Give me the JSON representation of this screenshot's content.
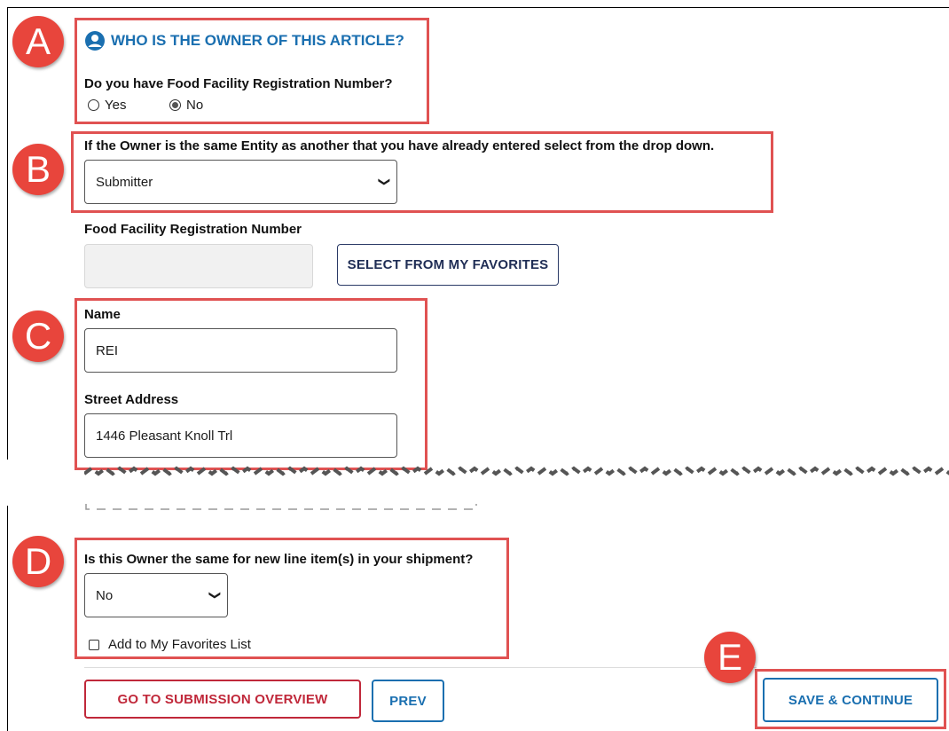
{
  "callouts": {
    "a": "A",
    "b": "B",
    "c": "C",
    "d": "D",
    "e": "E"
  },
  "owner_section": {
    "title": "WHO IS THE OWNER OF THIS ARTICLE?",
    "icon": "user-circle-icon",
    "question": "Do you have Food Facility Registration Number?",
    "options": {
      "yes": "Yes",
      "no": "No"
    },
    "selected": "No"
  },
  "same_entity": {
    "label": "If the Owner is the same Entity as another that you have already entered select from the drop down.",
    "selected": "Submitter"
  },
  "registration": {
    "label": "Food Facility Registration Number",
    "value": "",
    "favorites_button": "SELECT FROM MY FAVORITES"
  },
  "name": {
    "label": "Name",
    "value": "REI"
  },
  "street": {
    "label": "Street Address",
    "value": "1446 Pleasant Knoll Trl"
  },
  "line_items": {
    "label": "Is this Owner the same for new line item(s) in your shipment?",
    "selected": "No"
  },
  "favorites_checkbox": {
    "label": "Add to My Favorites List",
    "checked": false
  },
  "footer": {
    "overview_button": "GO TO SUBMISSION OVERVIEW",
    "prev_button": "PREV",
    "save_button": "SAVE & CONTINUE"
  },
  "colors": {
    "accent": "#1a6fb0",
    "callout": "#e05252",
    "danger": "#c0283a"
  }
}
